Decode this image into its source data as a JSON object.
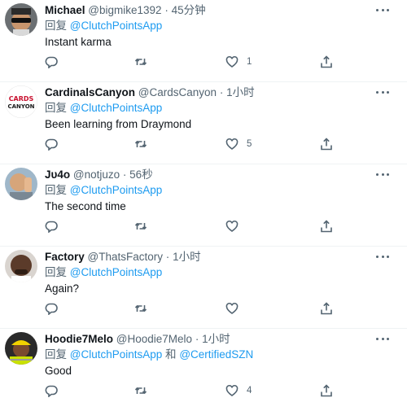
{
  "tweets": [
    {
      "name": "Michael",
      "handle": "@bigmike1392",
      "sep": "·",
      "time": "45分钟",
      "reply_prefix": "回复",
      "reply_to": "@ClutchPointsApp",
      "reply_join": "",
      "reply_to2": "",
      "text": "Instant karma",
      "likes": "1",
      "avatar": "avatar-sunglasses"
    },
    {
      "name": "CardinalsCanyon",
      "handle": "@CardsCanyon",
      "sep": "·",
      "time": "1小时",
      "reply_prefix": "回复",
      "reply_to": "@ClutchPointsApp",
      "reply_join": "",
      "reply_to2": "",
      "text": "Been learning from Draymond",
      "likes": "5",
      "avatar": "avatar-cards-canyon",
      "avatar_text": "CARDS CANYON"
    },
    {
      "name": "Jυ4o",
      "handle": "@notjuzo",
      "sep": "·",
      "time": "56秒",
      "reply_prefix": "回复",
      "reply_to": "@ClutchPointsApp",
      "reply_join": "",
      "reply_to2": "",
      "text": "The second time",
      "likes": "",
      "avatar": "avatar-thumbs-up"
    },
    {
      "name": "Factory",
      "handle": "@ThatsFactory",
      "sep": "·",
      "time": "1小时",
      "reply_prefix": "回复",
      "reply_to": "@ClutchPointsApp",
      "reply_join": "",
      "reply_to2": "",
      "text": "Again?",
      "likes": "",
      "avatar": "avatar-bald-man"
    },
    {
      "name": "Hoodie7Melo",
      "handle": "@Hoodie7Melo",
      "sep": "·",
      "time": "1小时",
      "reply_prefix": "回复",
      "reply_to": "@ClutchPointsApp",
      "reply_join": "和",
      "reply_to2": "@CertifiedSZN",
      "text": "Good",
      "likes": "4",
      "avatar": "avatar-hard-hat"
    }
  ],
  "colors": {
    "link": "#1d9bf0",
    "secondary": "#536471",
    "text": "#0f1419"
  },
  "icons": [
    "reply-icon",
    "retweet-icon",
    "like-icon",
    "share-icon",
    "more-icon"
  ]
}
